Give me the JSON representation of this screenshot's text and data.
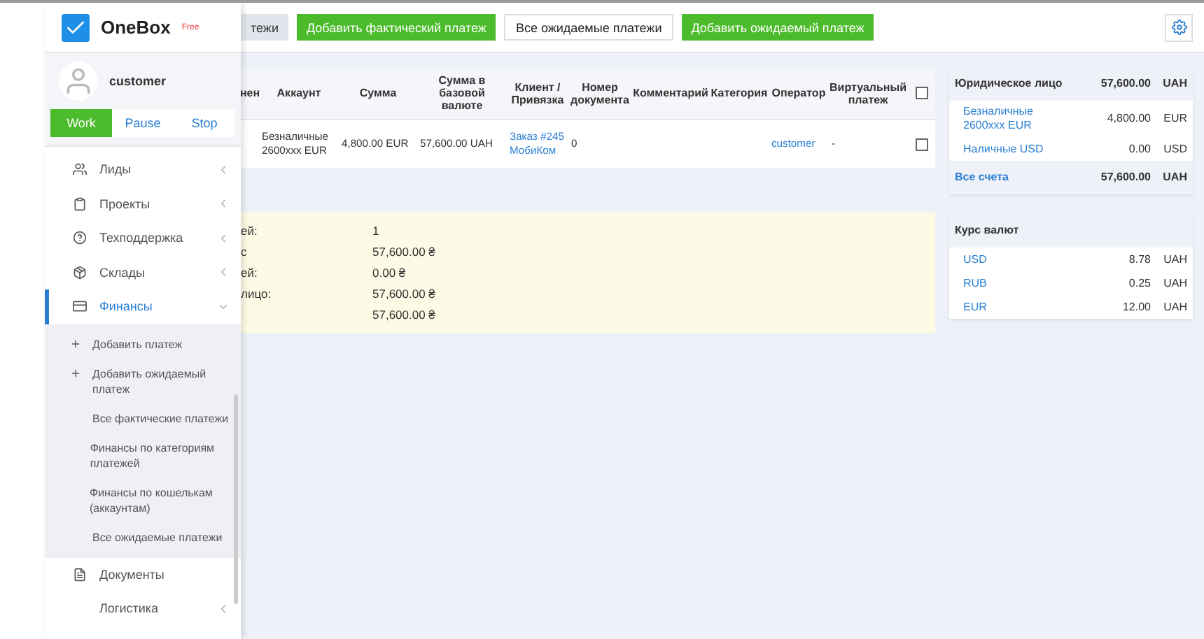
{
  "logo": {
    "name": "OneBox",
    "badge": "Free"
  },
  "user": {
    "name": "customer"
  },
  "timer_buttons": [
    {
      "label": "Work",
      "selected": true
    },
    {
      "label": "Pause",
      "selected": false
    },
    {
      "label": "Stop",
      "selected": false
    }
  ],
  "sidebar": {
    "items": [
      {
        "label": "Лиды",
        "expanded": false,
        "selected": false,
        "has_children": true
      },
      {
        "label": "Проекты",
        "expanded": false,
        "selected": false,
        "has_children": true
      },
      {
        "label": "Техподдержка",
        "expanded": false,
        "selected": false,
        "has_children": true
      },
      {
        "label": "Склады",
        "expanded": false,
        "selected": false,
        "has_children": true
      },
      {
        "label": "Финансы",
        "expanded": true,
        "selected": true,
        "has_children": true,
        "children": [
          {
            "label": "Добавить платеж",
            "plus": true
          },
          {
            "label": "Добавить ожидаемый платеж",
            "plus": true
          },
          {
            "label": "Все фактические платежи",
            "plus": false
          },
          {
            "label": "Финансы по категориям платежей",
            "plus": false
          },
          {
            "label": "Финансы по кошелькам (аккаунтам)",
            "plus": false
          },
          {
            "label": "Все ожидаемые платежи",
            "plus": false
          }
        ]
      },
      {
        "label": "Документы",
        "expanded": false,
        "selected": false,
        "has_children": false
      },
      {
        "label": "Логистика",
        "expanded": false,
        "selected": false,
        "has_children": true
      }
    ]
  },
  "toolbar": {
    "buttons": [
      {
        "label": "тежи",
        "kind": "grey"
      },
      {
        "label": "Добавить фактический платеж",
        "kind": "green"
      },
      {
        "label": "Все ожидаемые платежи",
        "kind": "white"
      },
      {
        "label": "Добавить ожидаемый платеж",
        "kind": "green"
      }
    ]
  },
  "table": {
    "columns": [
      "нен",
      "Аккаунт",
      "Сумма",
      "Сумма в базовой валюте",
      "Клиент / Привязка",
      "Номер документа",
      "Комментарий",
      "Категория",
      "Оператор",
      "Виртуальный платеж"
    ],
    "header_checked": false,
    "rows": [
      {
        "cells": [
          "",
          "Безналичные 2600xxx EUR",
          "4,800.00 EUR",
          "57,600.00 UAH",
          "Заказ #245 МобиКом",
          "0",
          "",
          "",
          "customer",
          "-"
        ],
        "checked": false
      }
    ]
  },
  "summary": [
    {
      "label": "ей:",
      "value": "1"
    },
    {
      "label": "с",
      "value": "57,600.00 ₴"
    },
    {
      "label": "ей:",
      "value": "0.00 ₴"
    },
    {
      "label": "лицо:",
      "value": "57,600.00 ₴"
    },
    {
      "value": "57,600.00 ₴"
    }
  ],
  "accounts": {
    "header": {
      "name": "Юридическое лицо",
      "amount": "57,600.00",
      "currency": "UAH"
    },
    "rows": [
      {
        "name": "Безналичные 2600xxx EUR",
        "amount": "4,800.00",
        "currency": "EUR"
      },
      {
        "name": "Наличные USD",
        "amount": "0.00",
        "currency": "USD"
      }
    ],
    "total": {
      "name": "Все счета",
      "amount": "57,600.00",
      "currency": "UAH"
    }
  },
  "rates": {
    "title": "Курс валют",
    "rows": [
      {
        "name": "USD",
        "amount": "8.78",
        "currency": "UAH"
      },
      {
        "name": "RUB",
        "amount": "0.25",
        "currency": "UAH"
      },
      {
        "name": "EUR",
        "amount": "12.00",
        "currency": "UAH"
      }
    ]
  }
}
